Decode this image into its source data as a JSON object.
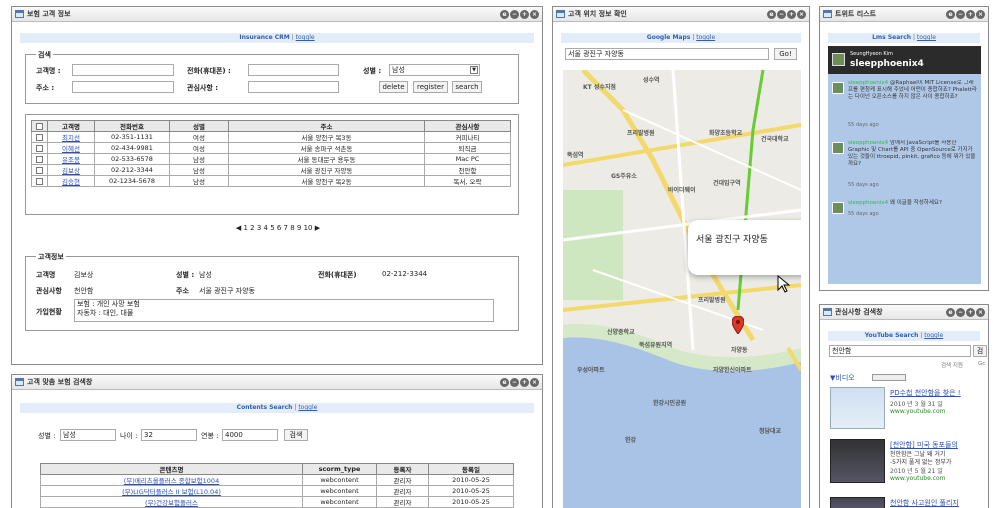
{
  "colors": {
    "accent": "#2f5fb4",
    "link": "#2a4fc4",
    "map_park": "#cfe7c0",
    "map_river": "#a8c3e6",
    "tweet_bg": "#b0c8e8"
  },
  "customer_panel": {
    "title": "보험 고객 정보",
    "lnbar": {
      "title": "Insurance CRM",
      "sep": "|",
      "toggle": "toggle"
    },
    "search": {
      "legend": "검색",
      "name_label": "고객명 :",
      "phone_label": "전화(휴대폰) :",
      "gender_label": "성별 :",
      "gender_value": "남성",
      "address_label": "주소 :",
      "interest_label": "관심사항 :",
      "buttons": {
        "delete": "delete",
        "register": "register",
        "search": "search"
      }
    },
    "table": {
      "headers": [
        "고객명",
        "전화번호",
        "성별",
        "주소",
        "관심사항"
      ],
      "rows": [
        [
          "최지선",
          "02-351-1131",
          "여성",
          "서울 양천구 목3동",
          "커피나티"
        ],
        [
          "이혜선",
          "02-434-9981",
          "여성",
          "서울 송파구 석촌동",
          "퇴직금"
        ],
        [
          "유조봉",
          "02-533-6578",
          "남성",
          "서울 동대문구 용두동",
          "Mac PC"
        ],
        [
          "김보상",
          "02-212-3344",
          "남성",
          "서울 광진구 자양동",
          "천안함"
        ],
        [
          "김승현",
          "02-1234-5678",
          "남성",
          "서울 양천구 목2동",
          "독서, 오락"
        ]
      ]
    },
    "pagination": {
      "prev": "◀",
      "pages": "1 2 3 4 5 6 7 8 9 10",
      "next": "▶"
    },
    "info": {
      "legend": "고객정보",
      "name_label": "고객명",
      "name_value": "김보상",
      "gender_label": "성별 :",
      "gender_value": "남성",
      "phone_label": "전화(휴대폰)",
      "phone_value": "02-212-3344",
      "interest_label": "관심사항",
      "interest_value": "천안함",
      "address_label": "주소",
      "address_value": "서울 광진구 자양동",
      "insurance_label": "가입현황",
      "insurance_value": "보험 : 개인 사망 보험\n자동차 : 대인, 대물"
    }
  },
  "recommend_panel": {
    "title": "고객 맞춤 보험 검색창",
    "lnbar": {
      "title": "Contents Search",
      "sep": "|",
      "toggle": "toggle"
    },
    "filter": {
      "gender_label": "성별 :",
      "gender_value": "남성",
      "age_label": "나이 :",
      "age_value": "32",
      "income_label": "연봉 :",
      "income_value": "4000",
      "search_button": "검색"
    },
    "table": {
      "headers": [
        "콘텐츠명",
        "scorm_type",
        "등록자",
        "등록일"
      ],
      "rows": [
        [
          "(무)메리츠올플러스 종합보험1004",
          "webcontent",
          "관리자",
          "2010-05-25"
        ],
        [
          "(무)LIG닥터플러스 II 보험(L10.04)",
          "webcontent",
          "관리자",
          "2010-05-25"
        ],
        [
          "(무)건강보험플러스",
          "webcontent",
          "관리자",
          "2010-05-25"
        ]
      ]
    }
  },
  "map_panel": {
    "title": "고객 위치 정보 확인",
    "lnbar": {
      "title": "Google Maps",
      "sep": "|",
      "toggle": "toggle"
    },
    "search_value": "서울 광진구 자양동",
    "go_button": "Go!",
    "bubble_text": "서울 광진구 자양동",
    "labels": [
      "KT 성수지점",
      "성수역",
      "프리발병원",
      "화양초등학교",
      "건국대학교",
      "뚝섬역",
      "GS주유소",
      "건대입구역",
      "바이더웨이",
      "프리발병원",
      "신양중학교",
      "뚝섬유원지역",
      "자양한신아파트",
      "한강시민공원",
      "자양동",
      "청담대교",
      "한강",
      "우성아파트"
    ]
  },
  "twitter_panel": {
    "title": "트위트 리스트",
    "lnbar": {
      "title": "Lms Search",
      "sep": "|",
      "toggle": "toggle"
    },
    "profile_name": "SeungHyeon Kim",
    "profile_handle": "sleepphoenix4",
    "tweets": [
      {
        "user": "sleepphoenix4",
        "text": "@Raphael이 MIT License로 그래프를 편청케 표시해 주었네 어떤이 종합하죠? Phalett라는 다이넌 오픈소스를 하지 않은 사이 종합하죠?",
        "time": "55 days ago"
      },
      {
        "user": "sleepphoenix4",
        "text": "앞에서 JavaScript를 사용한 Graphic 및 Chart를 API 중 OpenSource로 가지가 있는 것들이 ttroepid, pinkit, grafico 등에 뭐가 있을까요?",
        "time": "55 days ago"
      },
      {
        "user": "sleepphoenix4",
        "text": "왜 이글을 작성하세요?",
        "time": "55 days ago"
      }
    ]
  },
  "interest_panel": {
    "title": "관심사항 검색창",
    "lnbar": {
      "title": "YouTube Search",
      "sep": "|",
      "toggle": "toggle"
    },
    "search_value": "천안함",
    "search_button": "검",
    "search_by": "검색 지원",
    "search_by_cut": "Gc",
    "section_label": "▼비디오",
    "videos": [
      {
        "title": "PD수첩 천안함을 찾은 !",
        "meta": "2010 년 3 월 31 일",
        "site": "www.youtube.com"
      },
      {
        "title": "[천안함] 미국 동포들의",
        "snippet": "천안함은 그날 왜 거기",
        "snippet2": "-5가지 풀게 없는 정부가",
        "meta": "2010 년 5 월 21 일",
        "site": "www.youtube.com"
      },
      {
        "title": "천안함 사고원인 풀리지",
        "meta": "",
        "site": ""
      }
    ]
  }
}
